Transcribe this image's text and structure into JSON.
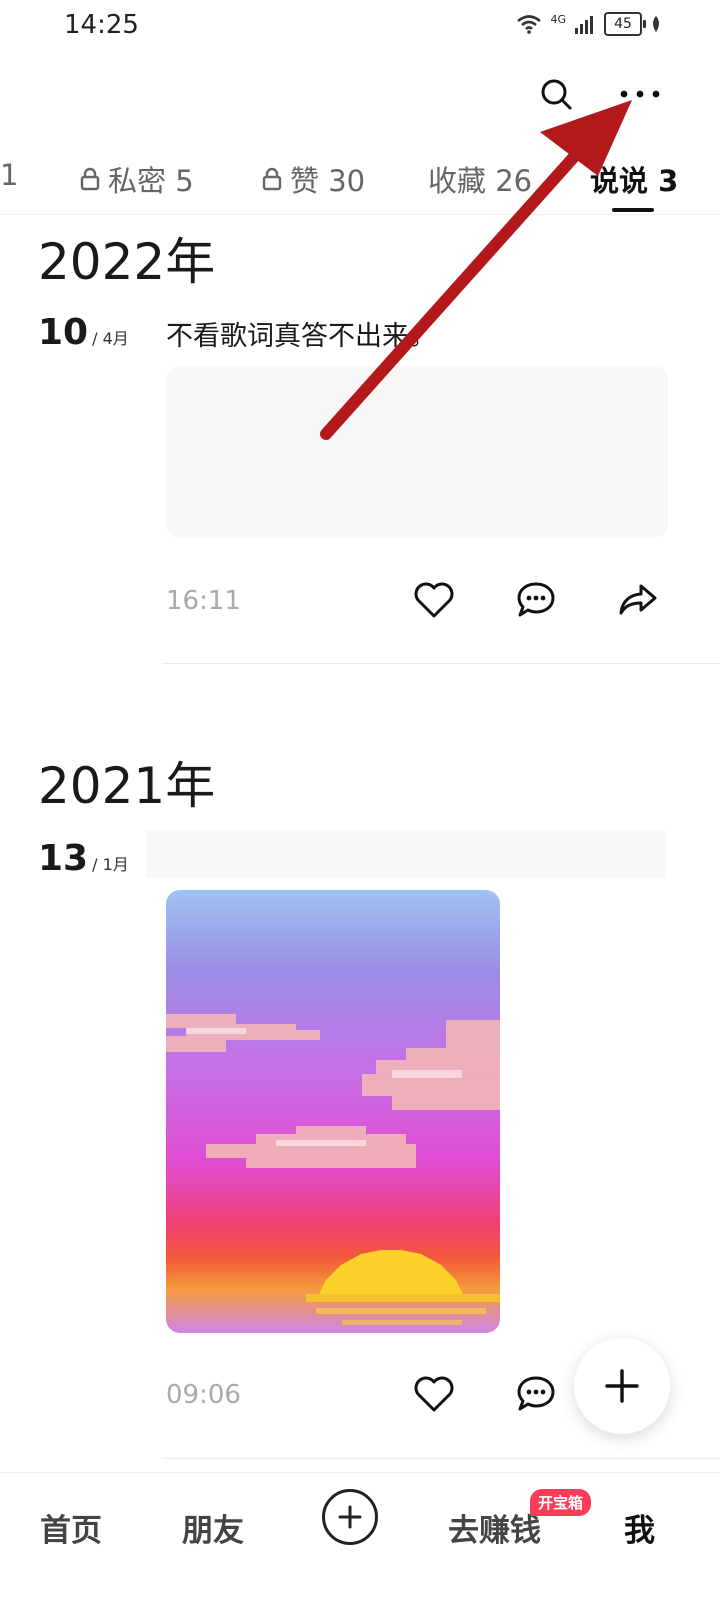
{
  "status_bar": {
    "time": "14:25",
    "network": "4G",
    "battery": "45"
  },
  "tabs": [
    {
      "label": "1",
      "locked": false
    },
    {
      "label": "私密 5",
      "locked": true
    },
    {
      "label": "赞 30",
      "locked": true
    },
    {
      "label": "收藏 26",
      "locked": false
    },
    {
      "label": "说说 3",
      "locked": false,
      "active": true
    }
  ],
  "posts": [
    {
      "year": "2022年",
      "day": "10",
      "month": "/ 4月",
      "text": "不看歌词真答不出来。",
      "time": "16:11"
    },
    {
      "year": "2021年",
      "day": "13",
      "month": "/ 1月",
      "text": "",
      "time": "09:06"
    }
  ],
  "bottom_nav": {
    "home": "首页",
    "friends": "朋友",
    "earn": "去赚钱",
    "earn_badge": "开宝箱",
    "me": "我"
  },
  "colors": {
    "badge": "#ff3b5c",
    "annotation_arrow": "#c0191b"
  }
}
